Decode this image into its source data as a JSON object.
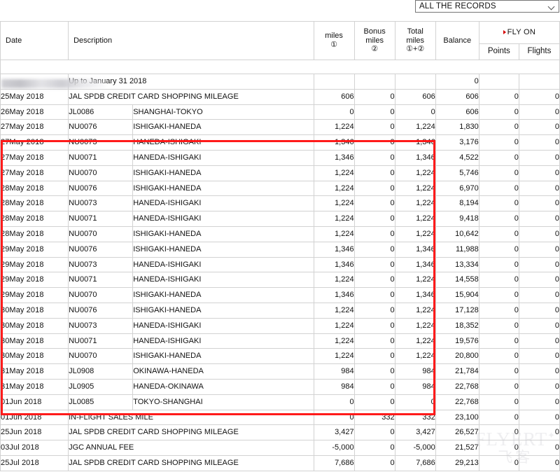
{
  "filter": {
    "selected": "ALL THE RECORDS",
    "icon": "chevron-down-icon"
  },
  "table": {
    "headers": {
      "date": "Date",
      "description": "Description",
      "miles": "miles",
      "miles_note": "①",
      "bonus_miles": "Bonus\nmiles",
      "bonus_miles_l1": "Bonus",
      "bonus_miles_l2": "miles",
      "bonus_note": "②",
      "total_miles_l1": "Total",
      "total_miles_l2": "miles",
      "total_note": "①+②",
      "balance": "Balance",
      "fly_on": "FLY ON",
      "points": "Points",
      "flights": "Flights"
    },
    "rows": [
      {
        "date": "",
        "code": "",
        "desc": "Up to January 31 2018",
        "miles": "",
        "bonus": "",
        "total": "",
        "balance": "0",
        "points": "",
        "flights": "",
        "span_desc": true
      },
      {
        "date": "25May 2018",
        "code": "",
        "desc": "JAL SPDB CREDIT CARD SHOPPING MILEAGE",
        "miles": "606",
        "bonus": "0",
        "total": "606",
        "balance": "606",
        "points": "0",
        "flights": "0",
        "span_desc": true
      },
      {
        "date": "26May 2018",
        "code": "JL0086",
        "desc": "SHANGHAI-TOKYO",
        "miles": "0",
        "bonus": "0",
        "total": "0",
        "balance": "606",
        "points": "0",
        "flights": "0",
        "span_desc": false
      },
      {
        "date": "27May 2018",
        "code": "NU0076",
        "desc": "ISHIGAKI-HANEDA",
        "miles": "1,224",
        "bonus": "0",
        "total": "1,224",
        "balance": "1,830",
        "points": "0",
        "flights": "0",
        "span_desc": false
      },
      {
        "date": "27May 2018",
        "code": "NU0073",
        "desc": "HANEDA-ISHIGAKI",
        "miles": "1,346",
        "bonus": "0",
        "total": "1,346",
        "balance": "3,176",
        "points": "0",
        "flights": "0",
        "span_desc": false
      },
      {
        "date": "27May 2018",
        "code": "NU0071",
        "desc": "HANEDA-ISHIGAKI",
        "miles": "1,346",
        "bonus": "0",
        "total": "1,346",
        "balance": "4,522",
        "points": "0",
        "flights": "0",
        "span_desc": false
      },
      {
        "date": "27May 2018",
        "code": "NU0070",
        "desc": "ISHIGAKI-HANEDA",
        "miles": "1,224",
        "bonus": "0",
        "total": "1,224",
        "balance": "5,746",
        "points": "0",
        "flights": "0",
        "span_desc": false
      },
      {
        "date": "28May 2018",
        "code": "NU0076",
        "desc": "ISHIGAKI-HANEDA",
        "miles": "1,224",
        "bonus": "0",
        "total": "1,224",
        "balance": "6,970",
        "points": "0",
        "flights": "0",
        "span_desc": false
      },
      {
        "date": "28May 2018",
        "code": "NU0073",
        "desc": "HANEDA-ISHIGAKI",
        "miles": "1,224",
        "bonus": "0",
        "total": "1,224",
        "balance": "8,194",
        "points": "0",
        "flights": "0",
        "span_desc": false
      },
      {
        "date": "28May 2018",
        "code": "NU0071",
        "desc": "HANEDA-ISHIGAKI",
        "miles": "1,224",
        "bonus": "0",
        "total": "1,224",
        "balance": "9,418",
        "points": "0",
        "flights": "0",
        "span_desc": false
      },
      {
        "date": "28May 2018",
        "code": "NU0070",
        "desc": "ISHIGAKI-HANEDA",
        "miles": "1,224",
        "bonus": "0",
        "total": "1,224",
        "balance": "10,642",
        "points": "0",
        "flights": "0",
        "span_desc": false
      },
      {
        "date": "29May 2018",
        "code": "NU0076",
        "desc": "ISHIGAKI-HANEDA",
        "miles": "1,346",
        "bonus": "0",
        "total": "1,346",
        "balance": "11,988",
        "points": "0",
        "flights": "0",
        "span_desc": false
      },
      {
        "date": "29May 2018",
        "code": "NU0073",
        "desc": "HANEDA-ISHIGAKI",
        "miles": "1,346",
        "bonus": "0",
        "total": "1,346",
        "balance": "13,334",
        "points": "0",
        "flights": "0",
        "span_desc": false
      },
      {
        "date": "29May 2018",
        "code": "NU0071",
        "desc": "HANEDA-ISHIGAKI",
        "miles": "1,224",
        "bonus": "0",
        "total": "1,224",
        "balance": "14,558",
        "points": "0",
        "flights": "0",
        "span_desc": false
      },
      {
        "date": "29May 2018",
        "code": "NU0070",
        "desc": "ISHIGAKI-HANEDA",
        "miles": "1,346",
        "bonus": "0",
        "total": "1,346",
        "balance": "15,904",
        "points": "0",
        "flights": "0",
        "span_desc": false
      },
      {
        "date": "30May 2018",
        "code": "NU0076",
        "desc": "ISHIGAKI-HANEDA",
        "miles": "1,224",
        "bonus": "0",
        "total": "1,224",
        "balance": "17,128",
        "points": "0",
        "flights": "0",
        "span_desc": false
      },
      {
        "date": "30May 2018",
        "code": "NU0073",
        "desc": "HANEDA-ISHIGAKI",
        "miles": "1,224",
        "bonus": "0",
        "total": "1,224",
        "balance": "18,352",
        "points": "0",
        "flights": "0",
        "span_desc": false
      },
      {
        "date": "30May 2018",
        "code": "NU0071",
        "desc": "HANEDA-ISHIGAKI",
        "miles": "1,224",
        "bonus": "0",
        "total": "1,224",
        "balance": "19,576",
        "points": "0",
        "flights": "0",
        "span_desc": false
      },
      {
        "date": "30May 2018",
        "code": "NU0070",
        "desc": "ISHIGAKI-HANEDA",
        "miles": "1,224",
        "bonus": "0",
        "total": "1,224",
        "balance": "20,800",
        "points": "0",
        "flights": "0",
        "span_desc": false
      },
      {
        "date": "31May 2018",
        "code": "JL0908",
        "desc": "OKINAWA-HANEDA",
        "miles": "984",
        "bonus": "0",
        "total": "984",
        "balance": "21,784",
        "points": "0",
        "flights": "0",
        "span_desc": false
      },
      {
        "date": "31May 2018",
        "code": "JL0905",
        "desc": "HANEDA-OKINAWA",
        "miles": "984",
        "bonus": "0",
        "total": "984",
        "balance": "22,768",
        "points": "0",
        "flights": "0",
        "span_desc": false
      },
      {
        "date": "01Jun 2018",
        "code": "JL0085",
        "desc": "TOKYO-SHANGHAI",
        "miles": "0",
        "bonus": "0",
        "total": "0",
        "balance": "22,768",
        "points": "0",
        "flights": "0",
        "span_desc": false
      },
      {
        "date": "01Jun 2018",
        "code": "",
        "desc": "IN-FLIGHT SALES MILE",
        "miles": "0",
        "bonus": "332",
        "total": "332",
        "balance": "23,100",
        "points": "0",
        "flights": "0",
        "span_desc": true
      },
      {
        "date": "25Jun 2018",
        "code": "",
        "desc": "JAL SPDB CREDIT CARD SHOPPING MILEAGE",
        "miles": "3,427",
        "bonus": "0",
        "total": "3,427",
        "balance": "26,527",
        "points": "0",
        "flights": "0",
        "span_desc": true
      },
      {
        "date": "03Jul 2018",
        "code": "",
        "desc": "JGC ANNUAL FEE",
        "miles": "-5,000",
        "bonus": "0",
        "total": "-5,000",
        "balance": "21,527",
        "points": "0",
        "flights": "0",
        "span_desc": true
      },
      {
        "date": "25Jul 2018",
        "code": "",
        "desc": "JAL SPDB CREDIT CARD SHOPPING MILEAGE",
        "miles": "7,686",
        "bonus": "0",
        "total": "7,686",
        "balance": "29,213",
        "points": "0",
        "flights": "0",
        "span_desc": true
      }
    ]
  },
  "annotation": {
    "highlight_color": "#ff1a1a",
    "highlight_note": "red rectangle around flight rows 27May-31May 2018"
  },
  "watermark": {
    "main": "FLYERT",
    "star": "✦",
    "sub": "飞客"
  }
}
